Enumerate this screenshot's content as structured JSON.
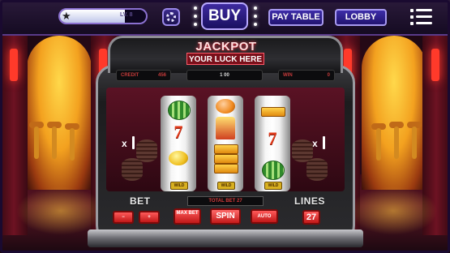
{
  "topbar": {
    "xp_label": "LV. 8",
    "xp_progress": 0.75,
    "buy_label": "BUY",
    "paytable_label": "PAY TABLE",
    "lobby_label": "LOBBY",
    "icons": [
      "star-icon",
      "gear-icon",
      "hamburger-menu-icon"
    ]
  },
  "machine": {
    "jackpot_title": "JACKPOT",
    "jackpot_subtitle": "YOUR LUCK HERE",
    "credit_label": "CREDIT",
    "credit_value": "456",
    "win_value": "1 00",
    "win_label": "WIN",
    "win_right_value": "0",
    "reels": [
      {
        "symbols": [
          "watermelon",
          "7",
          "lemon"
        ],
        "badge": "WILD"
      },
      {
        "symbols": [
          "orange",
          "jackpot-cake",
          "bar-stack"
        ],
        "badge": "WILD"
      },
      {
        "symbols": [
          "bar",
          "7",
          "watermelon"
        ],
        "badge": "WILD"
      }
    ],
    "left_multiplier": "x",
    "right_multiplier": "x",
    "total_bet": "TOTAL BET 27",
    "bet_label": "BET",
    "lines_label": "LINES",
    "buttons": {
      "minus": "−",
      "plus": "+",
      "max_bet": "MAX BET",
      "spin": "SPIN",
      "auto": "AUTO",
      "lines_value": "27"
    }
  },
  "colors": {
    "accent_purple": "#3d2da8",
    "jackpot_red": "#7a0f1a",
    "button_red": "#c01818",
    "gold": "#ffd84a"
  }
}
